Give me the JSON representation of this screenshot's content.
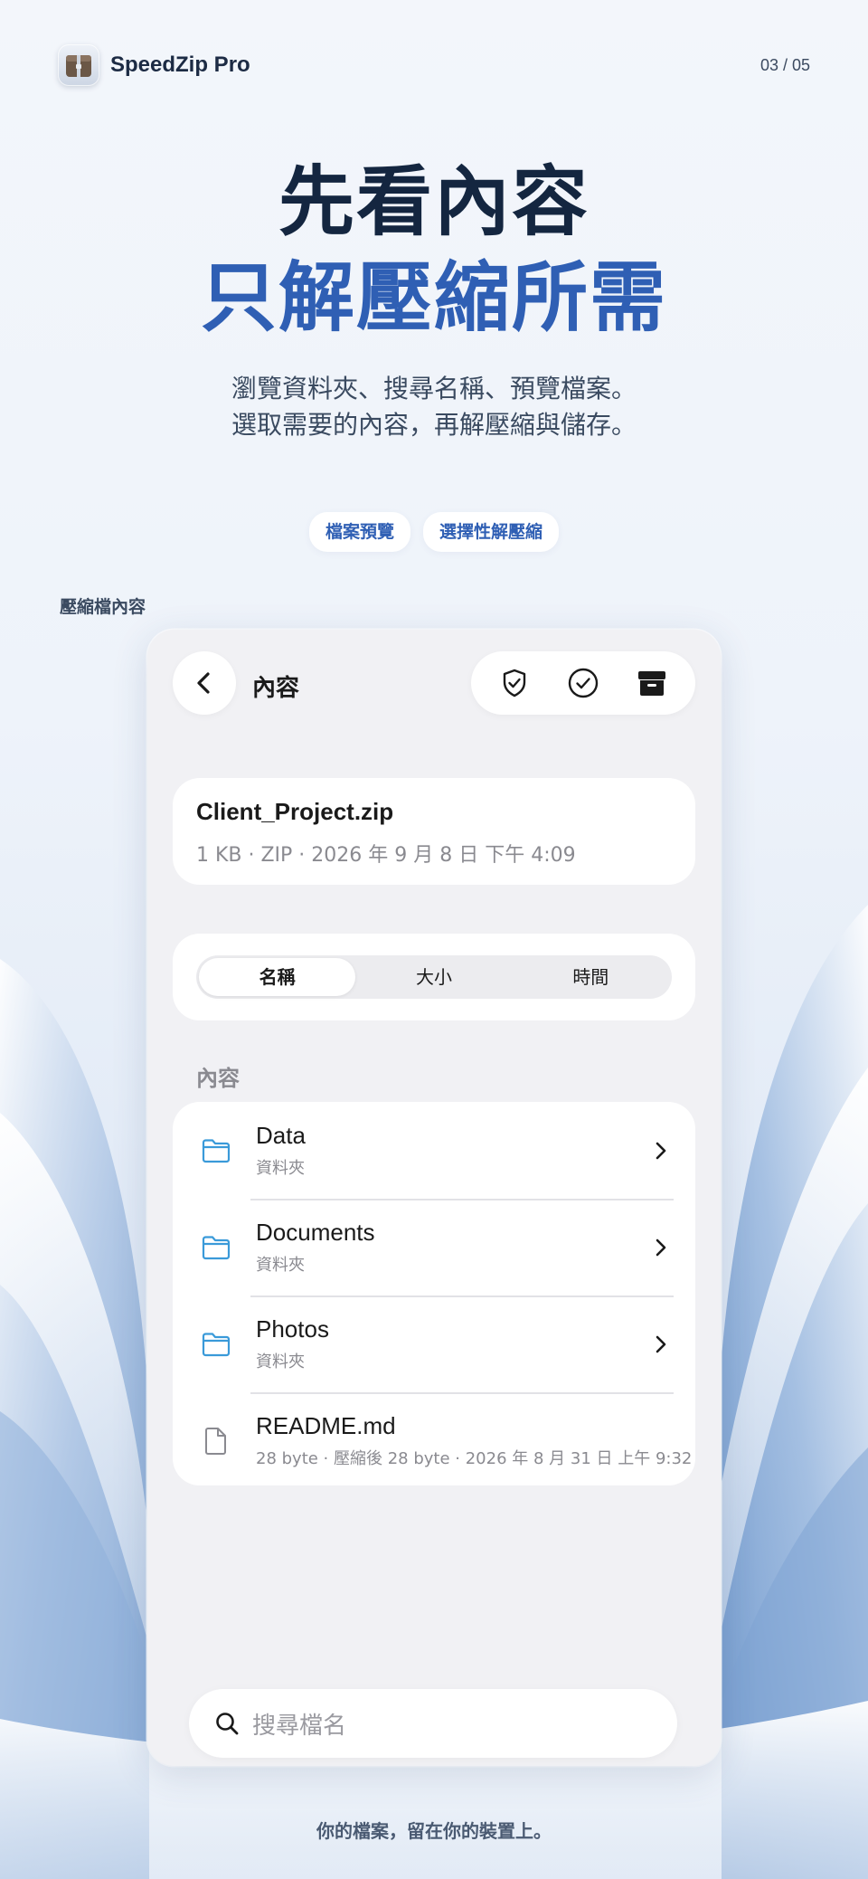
{
  "app": {
    "name": "SpeedZip Pro",
    "page_counter": "03 / 05"
  },
  "headline": {
    "line1": "先看內容",
    "line2": "只解壓縮所需"
  },
  "subtitle": {
    "line1": "瀏覽資料夾、搜尋名稱、預覽檔案。",
    "line2": "選取需要的內容，再解壓縮與儲存。"
  },
  "chips": [
    "檔案預覽",
    "選擇性解壓縮"
  ],
  "section_caption": "壓縮檔內容",
  "screen": {
    "nav_title": "內容",
    "actions": [
      "shield-check-icon",
      "check-circle-icon",
      "archive-box-icon"
    ],
    "file": {
      "name": "Client_Project.zip",
      "meta": "1 KB · ZIP · 2026 年 9 月 8 日 下午 4:09"
    },
    "sort": {
      "options": [
        "名稱",
        "大小",
        "時間"
      ],
      "selected": "名稱"
    },
    "list_header": "內容",
    "items": [
      {
        "name": "Data",
        "detail": "資料夾",
        "icon": "folder-icon"
      },
      {
        "name": "Documents",
        "detail": "資料夾",
        "icon": "folder-icon"
      },
      {
        "name": "Photos",
        "detail": "資料夾",
        "icon": "folder-icon"
      },
      {
        "name": "README.md",
        "detail": "28 byte · 壓縮後 28 byte · 2026 年 8 月 31 日 上午 9:32",
        "icon": "document-icon"
      }
    ],
    "search_placeholder": "搜尋檔名"
  },
  "footer": "你的檔案，留在你的裝置上。",
  "colors": {
    "accent": "#2f5fb4",
    "heading": "#142640",
    "folder": "#3a9ad9",
    "card": "#ffffff",
    "screen_bg": "#f1f1f4"
  }
}
